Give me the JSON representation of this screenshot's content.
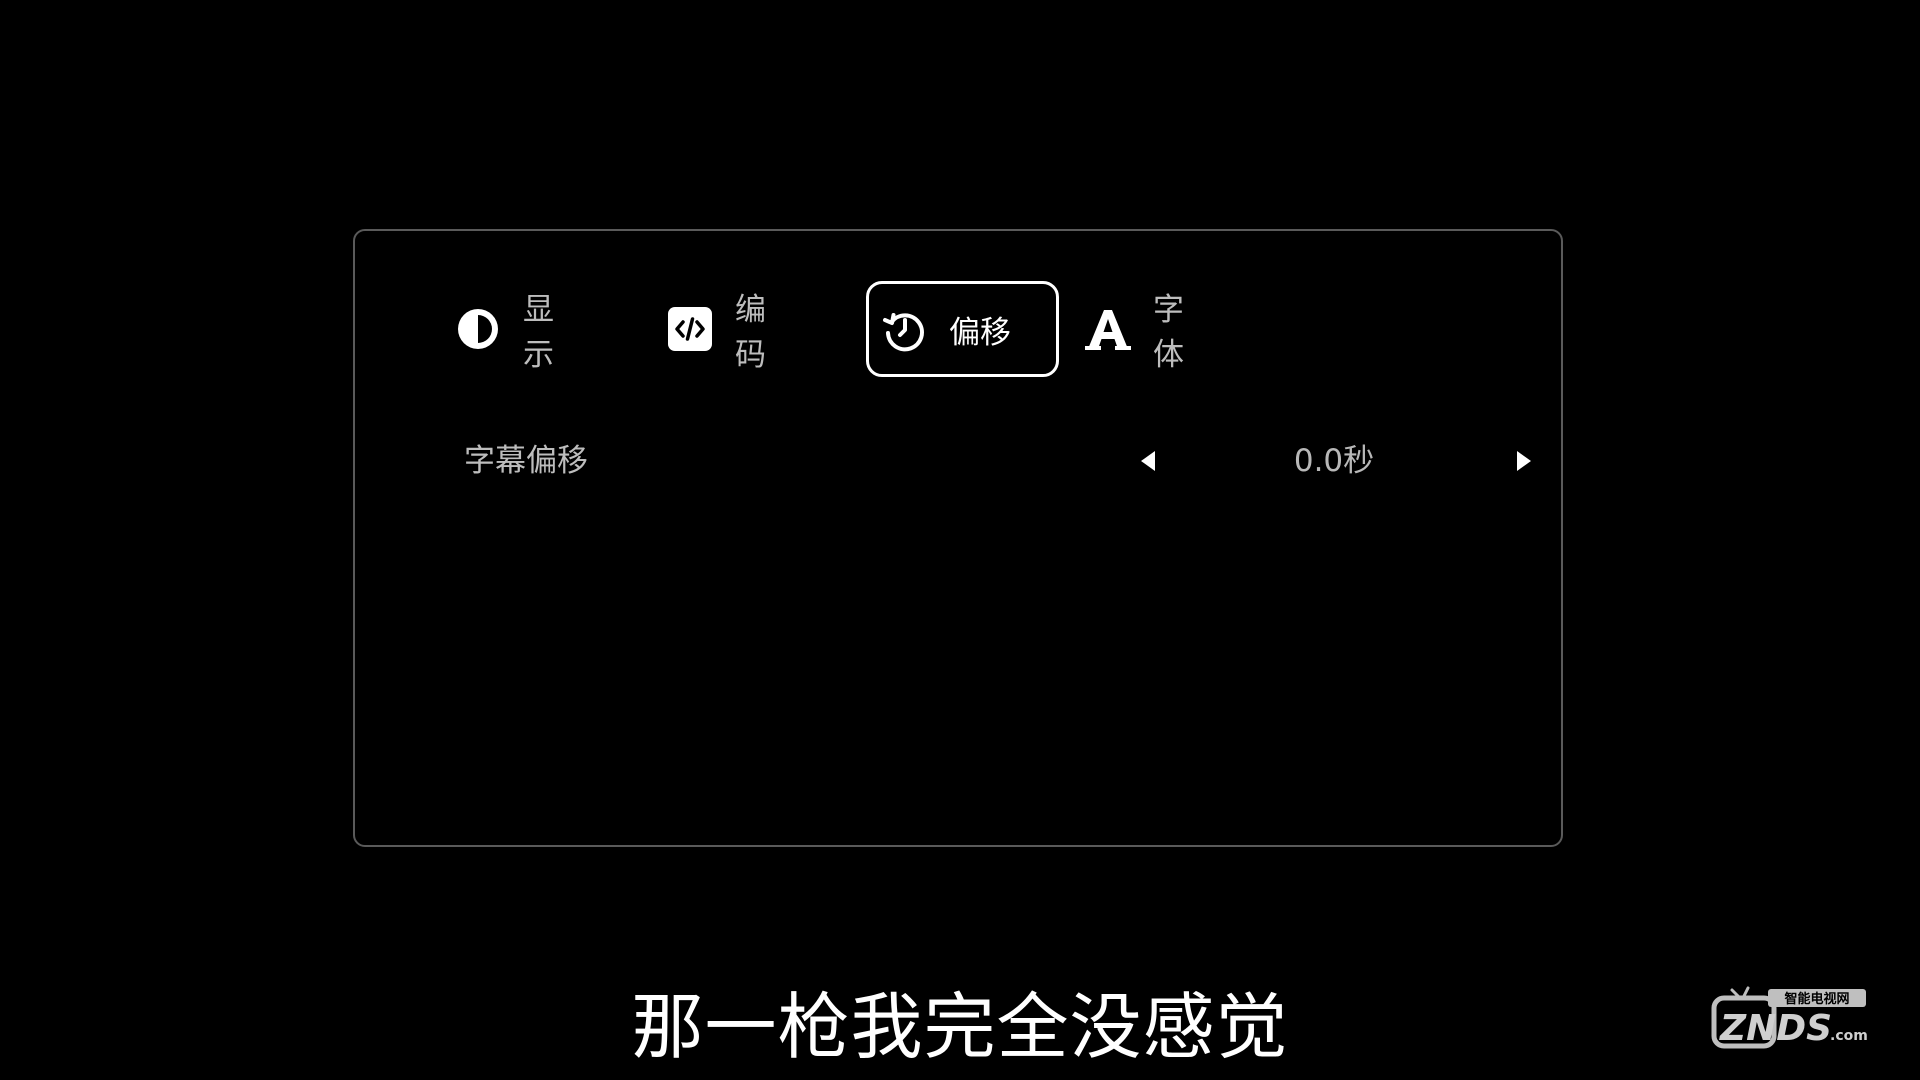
{
  "tabs": [
    {
      "label": "显示",
      "icon": "contrast-icon"
    },
    {
      "label": "编码",
      "icon": "code-icon"
    },
    {
      "label": "偏移",
      "icon": "history-icon"
    },
    {
      "label": "字体",
      "icon": "font-icon"
    }
  ],
  "selected_tab": "偏移",
  "setting": {
    "label": "字幕偏移",
    "value": "0.0秒",
    "prev_icon": "arrow-left-icon",
    "next_icon": "arrow-right-icon"
  },
  "subtitle": "那一枪我完全没感觉",
  "watermark": {
    "top_text": "智能电视网",
    "brand": "ZNDS",
    "suffix": ".com"
  }
}
